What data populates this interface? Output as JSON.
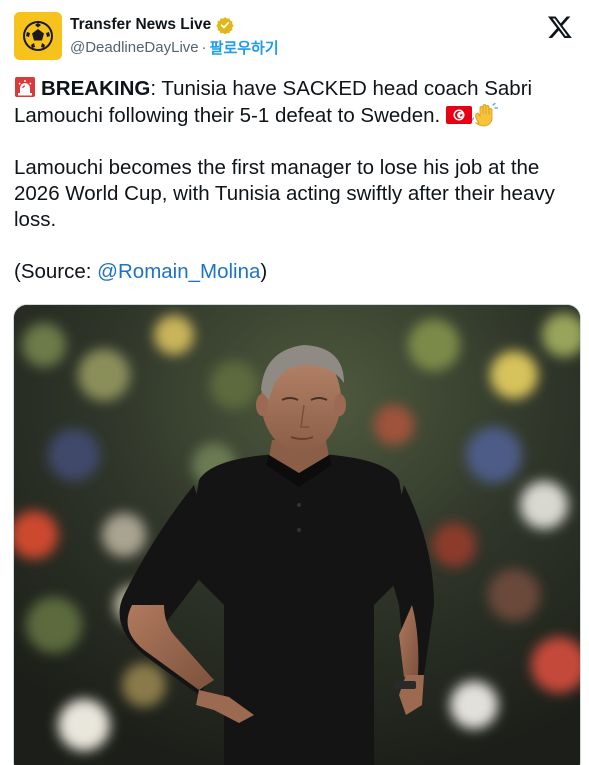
{
  "account": {
    "display_name": "Transfer News Live",
    "handle": "@DeadlineDayLive",
    "separator": "·",
    "follow_label": "팔로우하기",
    "verified": true,
    "avatar_icon": "football-icon"
  },
  "brand_icon": "x-logo-icon",
  "tweet": {
    "lead_icon": "rotating-light-emoji",
    "breaking_label": "BREAKING",
    "line1_rest": ": Tunisia have SACKED head coach Sabri Lamouchi following their 5-1 defeat to Sweden.",
    "emojis_after_line1": [
      "tunisia-flag-emoji",
      "waving-hand-emoji"
    ],
    "paragraph2": "Lamouchi becomes the first manager to lose his job at the 2026 World Cup, with Tunisia acting swiftly after their heavy loss.",
    "source_prefix": "(Source: ",
    "source_mention": "@Romain_Molina",
    "source_suffix": ")"
  },
  "colors": {
    "link": "#1d9bf0",
    "mention": "#1d73c4",
    "avatar_bg": "#f6c21c",
    "text": "#0f1419",
    "secondary_text": "#536471"
  },
  "media": {
    "subject": "man in black polo shirt standing with hands on hips in front of stadium crowd"
  }
}
